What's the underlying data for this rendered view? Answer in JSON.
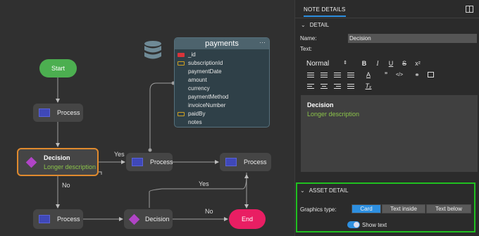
{
  "canvas": {
    "start_label": "Start",
    "end_label": "End",
    "nodes": {
      "process_1": "Process",
      "process_2": "Process",
      "process_3": "Process",
      "process_4": "Process",
      "decision_2": "Decision"
    },
    "selected_decision": {
      "title": "Decision",
      "subtitle": "Longer description"
    },
    "edge_labels": {
      "yes_1": "Yes",
      "no_1": "No",
      "yes_2": "Yes",
      "no_2": "No"
    },
    "table": {
      "name": "payments",
      "more": "···",
      "fields": [
        {
          "name": "_id",
          "key": "pk"
        },
        {
          "name": "subscriptionId",
          "key": "fk"
        },
        {
          "name": "paymentDate",
          "key": ""
        },
        {
          "name": "amount",
          "key": ""
        },
        {
          "name": "currency",
          "key": ""
        },
        {
          "name": "paymentMethod",
          "key": ""
        },
        {
          "name": "invoiceNumber",
          "key": ""
        },
        {
          "name": "paidBy",
          "key": "fk"
        },
        {
          "name": "notes",
          "key": ""
        }
      ]
    }
  },
  "panel": {
    "tab_label": "NOTE DETAILS",
    "detail_header": "DETAIL",
    "name_label": "Name:",
    "name_value": "Decision",
    "text_label": "Text:",
    "format_value": "Normal",
    "editor": {
      "line1": "Decision",
      "line2": "Longer description"
    },
    "asset_header": "ASSET DETAIL",
    "graphics_label": "Graphics type:",
    "graphics_options": [
      "Card",
      "Text inside",
      "Text below"
    ],
    "graphics_selected": "Card",
    "show_text_label": "Show text"
  },
  "colors": {
    "accent": "#2d8fe0",
    "start": "#4caf50",
    "end": "#e91e63",
    "selection": "#e08a2e",
    "highlight_box": "#20c020",
    "description": "#8bc34a"
  }
}
